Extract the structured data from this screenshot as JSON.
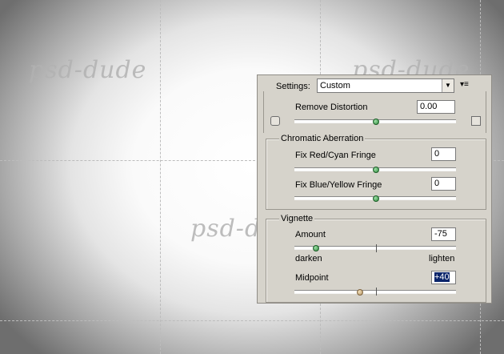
{
  "watermarks": [
    "psd-dude",
    "psd-dude",
    "psd-dude"
  ],
  "settings": {
    "label": "Settings:",
    "value": "Custom"
  },
  "remove_distortion": {
    "label": "Remove Distortion",
    "value": "0.00",
    "level": 0.5
  },
  "chromatic_aberration": {
    "title": "Chromatic Aberration",
    "red_cyan": {
      "label": "Fix Red/Cyan Fringe",
      "value": "0",
      "level": 0.5
    },
    "blue_yellow": {
      "label": "Fix Blue/Yellow Fringe",
      "value": "0",
      "level": 0.5
    }
  },
  "vignette": {
    "title": "Vignette",
    "amount": {
      "label": "Amount",
      "value": "-75",
      "level": 0.125,
      "min_label": "darken",
      "max_label": "lighten"
    },
    "midpoint": {
      "label": "Midpoint",
      "value": "+40",
      "level": 0.4
    }
  },
  "colors": {
    "panel_bg": "#d6d3cb",
    "selection": "#0a246a",
    "slider_thumb": "#2e8a3c"
  },
  "icons": [
    "dropdown-arrow-icon",
    "panel-menu-icon",
    "grid-left-icon",
    "grid-right-icon"
  ]
}
